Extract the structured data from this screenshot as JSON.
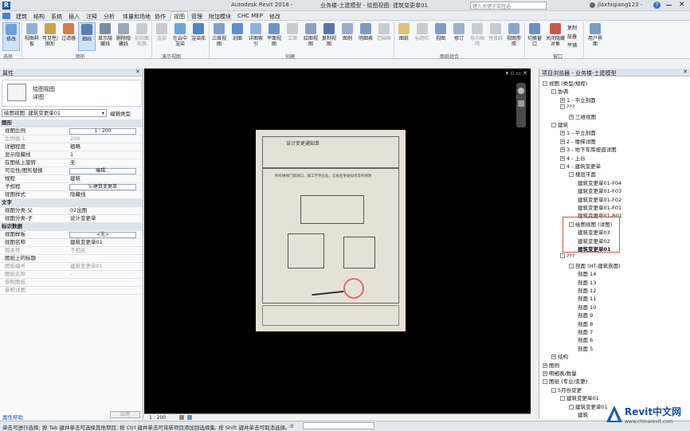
{
  "titlebar": {
    "app": "Autodesk Revit 2018 -",
    "doc": "业务楼-土建模型 - 绘图视图: 建筑变更单01",
    "search_placeholder": "键入关键字或短语",
    "user": "jiaxhiqiang123 -"
  },
  "menu": [
    "建筑",
    "结构",
    "系统",
    "插入",
    "注释",
    "分析",
    "体量和场地",
    "协作",
    "视图",
    "管理",
    "附加模块",
    "CHC MEP",
    "修改"
  ],
  "ribbon": {
    "buttons": [
      "修改",
      "视图样板",
      "可见性/图形",
      "过滤器",
      "细线",
      "显示隐藏线",
      "删除隐藏线",
      "剖切面轮廓",
      "渲染",
      "在云中渲染",
      "渲染库",
      "三维视图",
      "剖面",
      "详图索引",
      "平面视图",
      "立面",
      "绘图视图",
      "复制视图",
      "图例",
      "明细表",
      "范围框",
      "图纸",
      "标题栏",
      "视图",
      "修订",
      "导向轴网",
      "拼接线",
      "视图参照",
      "切换窗口",
      "关闭隐藏对象",
      "复制",
      "层叠",
      "平铺",
      "用户界面"
    ],
    "groups": [
      "选择",
      "图形",
      "演示视图",
      "创建",
      "图纸组合",
      "窗口"
    ]
  },
  "properties": {
    "header": "属性",
    "type_name": "绘图视图",
    "type_sub": "详图",
    "selector": "绘图视图: 建筑变更单01",
    "edit_type": "编辑类型",
    "rows": [
      {
        "k": "图形",
        "v": "",
        "cat": true
      },
      {
        "k": "视图比例",
        "v": "1 : 200",
        "box": true
      },
      {
        "k": "比例值 1:",
        "v": "200",
        "dim": true
      },
      {
        "k": "详细程度",
        "v": "粗略"
      },
      {
        "k": "显示隐藏线",
        "v": "1"
      },
      {
        "k": "在图纸上旋转",
        "v": "无"
      },
      {
        "k": "可见性/图形替换",
        "v": "编辑...",
        "box": true
      },
      {
        "k": "规程",
        "v": "建筑"
      },
      {
        "k": "子规程",
        "v": "5-建筑变更单",
        "box": true
      },
      {
        "k": "视图样式",
        "v": "隐藏线"
      },
      {
        "k": "文字",
        "v": "",
        "cat": true
      },
      {
        "k": "视图分类-父",
        "v": "02出图"
      },
      {
        "k": "视图分类-子",
        "v": "设计变更单"
      },
      {
        "k": "标识数据",
        "v": "",
        "cat": true
      },
      {
        "k": "视图样板",
        "v": "<无>",
        "box": true
      },
      {
        "k": "视图名称",
        "v": "建筑变更单01"
      },
      {
        "k": "相关性",
        "v": "不相关",
        "dim": true
      },
      {
        "k": "图纸上的标题",
        "v": ""
      },
      {
        "k": "图纸编号",
        "v": "建筑变更单01",
        "dim": true
      },
      {
        "k": "图纸名称",
        "v": "-",
        "dim": true
      },
      {
        "k": "参照图纸",
        "v": "",
        "dim": true
      },
      {
        "k": "参照详图",
        "v": "",
        "dim": true
      }
    ],
    "help": "属性帮助",
    "apply": "应用"
  },
  "browser": {
    "header": "项目浏览器 - 业务楼-土建模型",
    "items": [
      {
        "t": "视图 (类型/规程)",
        "d": 0,
        "e": "-"
      },
      {
        "t": "协调",
        "d": 1,
        "e": "-"
      },
      {
        "t": "1 - 平立剖面",
        "d": 2,
        "e": "+"
      },
      {
        "t": "???",
        "d": 2,
        "e": "-"
      },
      {
        "t": "三维视图",
        "d": 3,
        "e": "+"
      },
      {
        "t": "建筑",
        "d": 1,
        "e": "-"
      },
      {
        "t": "1 - 平立剖面",
        "d": 2,
        "e": "+"
      },
      {
        "t": "2 - 楼梯详图",
        "d": 2,
        "e": "+"
      },
      {
        "t": "3 - 地下车库坡道详图",
        "d": 2,
        "e": "+"
      },
      {
        "t": "4 - 上谷",
        "d": 2,
        "e": "+"
      },
      {
        "t": "4 - 建筑变更单",
        "d": 2,
        "e": "-"
      },
      {
        "t": "楼层平面",
        "d": 3,
        "e": "-"
      },
      {
        "t": "建筑变更单01-F04",
        "d": 4,
        "e": ""
      },
      {
        "t": "建筑变更单01-F03",
        "d": 4,
        "e": ""
      },
      {
        "t": "建筑变更单01-F02",
        "d": 4,
        "e": ""
      },
      {
        "t": "建筑变更单01-F01",
        "d": 4,
        "e": ""
      },
      {
        "t": "建筑变更单01-B01",
        "d": 4,
        "e": ""
      },
      {
        "t": "绘图视图 (详图)",
        "d": 3,
        "e": "-"
      },
      {
        "t": "建筑变更单03",
        "d": 4,
        "e": ""
      },
      {
        "t": "建筑变更单02",
        "d": 4,
        "e": ""
      },
      {
        "t": "建筑变更单01",
        "d": 4,
        "e": "",
        "b": true
      },
      {
        "t": "???",
        "d": 2,
        "e": "-"
      },
      {
        "t": "剖面 (HT-建筑剖面)",
        "d": 3,
        "e": "-"
      },
      {
        "t": "剖面 14",
        "d": 4,
        "e": ""
      },
      {
        "t": "剖面 13",
        "d": 4,
        "e": ""
      },
      {
        "t": "剖面 12",
        "d": 4,
        "e": ""
      },
      {
        "t": "剖面 11",
        "d": 4,
        "e": ""
      },
      {
        "t": "剖面 10",
        "d": 4,
        "e": ""
      },
      {
        "t": "剖面 9",
        "d": 4,
        "e": ""
      },
      {
        "t": "剖面 8",
        "d": 4,
        "e": ""
      },
      {
        "t": "剖面 7",
        "d": 4,
        "e": ""
      },
      {
        "t": "剖面 6",
        "d": 4,
        "e": ""
      },
      {
        "t": "剖面 5",
        "d": 4,
        "e": ""
      },
      {
        "t": "结构",
        "d": 1,
        "e": "+"
      },
      {
        "t": "图例",
        "d": 0,
        "e": "+"
      },
      {
        "t": "明细表/数量",
        "d": 0,
        "e": "+"
      },
      {
        "t": "图纸 (专业/变更)",
        "d": 0,
        "e": "-"
      },
      {
        "t": "5月份变更",
        "d": 1,
        "e": "-"
      },
      {
        "t": "建筑变更单01",
        "d": 2,
        "e": "-"
      },
      {
        "t": "建筑变更单01",
        "d": 3,
        "e": "-"
      },
      {
        "t": "建筑",
        "d": 4,
        "e": ""
      }
    ]
  },
  "document": {
    "title": "设计变更通知单",
    "remark": "所有楼梯门窗洞口、施工不到位处，应按变更通知单及时修改"
  },
  "viewbar": {
    "scale": "1 : 200"
  },
  "statusbar": {
    "hint": "单击可进行选择; 按 Tab 键并单击可选择其他项目; 按 Ctrl 键并单击可将新项目添加到选择集; 按 Shift 键并单击可取消选择。",
    "zero": ":0"
  },
  "watermark": {
    "brand": "Revit中文网",
    "url": "www.chinarevit.com"
  }
}
